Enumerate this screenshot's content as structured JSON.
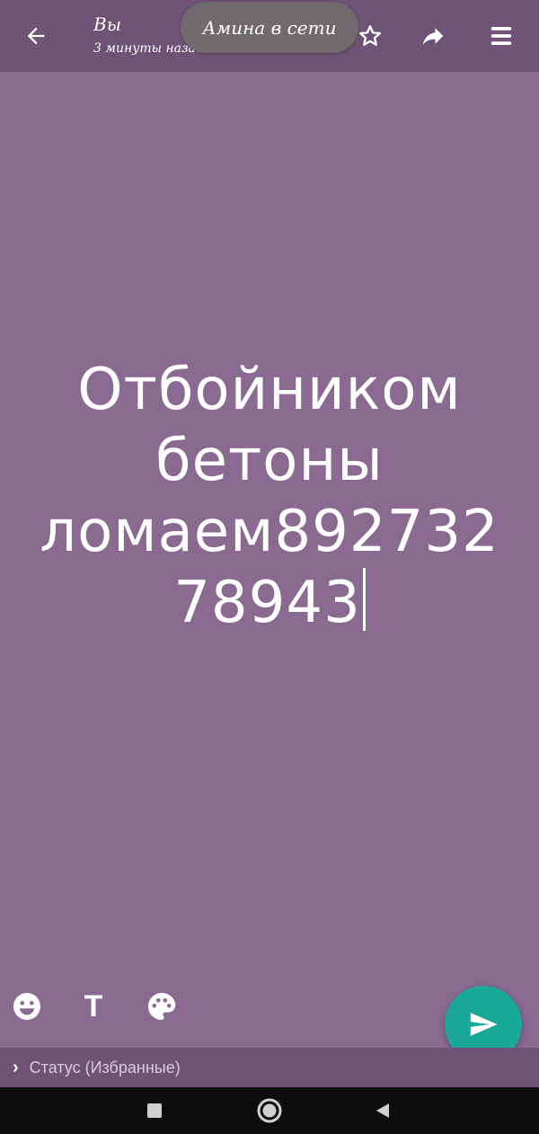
{
  "header": {
    "title": "Вы",
    "subtitle": "3 минуты назад",
    "toast": "Амина в сети"
  },
  "status": {
    "lines": [
      "Отбойником",
      "бетоны",
      "ломаем892732",
      "78943"
    ]
  },
  "footer": {
    "text_tool_label": "T",
    "audience_label": "Статус (Избранные)"
  },
  "colors": {
    "background": "#8a6a91",
    "bar": "#6f5377",
    "send_button": "#1aa89a"
  },
  "icons": {
    "back": "arrow-left-icon",
    "star": "star-icon",
    "share": "share-icon",
    "menu": "menu-icon",
    "emoji": "emoji-icon",
    "text": "text-icon",
    "palette": "palette-icon",
    "send": "send-icon"
  }
}
